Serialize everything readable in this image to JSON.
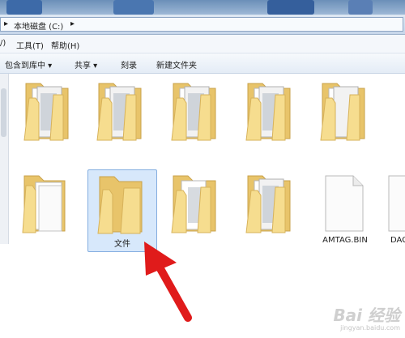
{
  "breadcrumb": {
    "arrow": "▸",
    "location": "本地磁盘 (C:)",
    "next_arrow": "▸"
  },
  "menu": {
    "edit_fragment": "/)",
    "tools": "工具(T)",
    "help": "帮助(H)"
  },
  "toolbar": {
    "include_library": "包含到库中 ▾",
    "share": "共享 ▾",
    "burn": "刻录",
    "new_folder": "新建文件夹"
  },
  "items": [
    {
      "type": "folder-with-files",
      "label": ""
    },
    {
      "type": "folder-with-files",
      "label": ""
    },
    {
      "type": "folder-with-files",
      "label": ""
    },
    {
      "type": "folder-with-files",
      "label": ""
    },
    {
      "type": "folder-with-files",
      "label": ""
    },
    {
      "type": "folder-with-white-doc",
      "label": ""
    },
    {
      "type": "folder-empty",
      "label": "文件",
      "selected": true
    },
    {
      "type": "folder-with-files",
      "label": ""
    },
    {
      "type": "folder-with-files",
      "label": ""
    },
    {
      "type": "file",
      "label": "AMTAG.BIN"
    },
    {
      "type": "file",
      "label": "DAG"
    }
  ],
  "annotation": {
    "icon": "red-arrow-icon",
    "color": "#e01b1b"
  },
  "watermark": {
    "brand": "Bai  经验",
    "url": "jingyan.baidu.com"
  },
  "colors": {
    "folder_back": "#e8c46a",
    "folder_front": "#f6dd8f",
    "selection_bg": "#d7e8fb",
    "selection_border": "#84aee0",
    "title_strip": "#6b8fb8"
  }
}
